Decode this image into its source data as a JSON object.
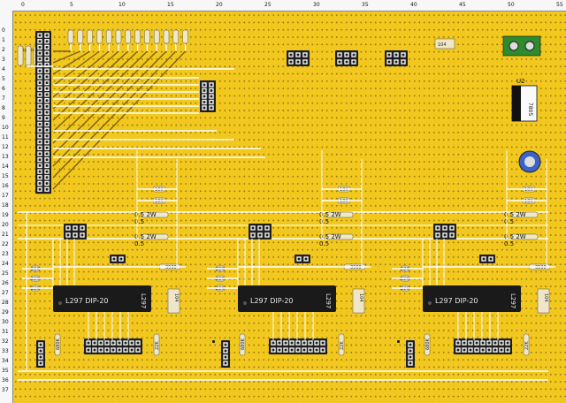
{
  "rulers": {
    "top": [
      "0",
      "5",
      "10",
      "15",
      "20",
      "25",
      "30",
      "35",
      "40",
      "45",
      "50",
      "55"
    ],
    "left": [
      "0",
      "1",
      "2",
      "3",
      "4",
      "5",
      "6",
      "7",
      "8",
      "9",
      "10",
      "11",
      "12",
      "13",
      "14",
      "15",
      "16",
      "17",
      "18",
      "19",
      "20",
      "21",
      "22",
      "23",
      "24",
      "25",
      "26",
      "27",
      "28",
      "29",
      "30",
      "31",
      "32",
      "33",
      "34",
      "35",
      "36",
      "37"
    ]
  },
  "parts": {
    "chip_label": "L297",
    "chip_package": "DIP-20",
    "chip_side": "L297",
    "regulator_name": "U2",
    "regulator_part": "7805",
    "res_10k": "10K",
    "res_05": "0.5",
    "res_05_2w": "0.5  2W",
    "res_3900": "3900",
    "res_22k": "22K",
    "res_680k": "680K",
    "res_1k": "1k",
    "small_cap": "104"
  },
  "colors": {
    "board": "#f2c81f",
    "trace": "#ffffff",
    "chip": "#1a1a1a",
    "terminal": "#2e8b2e"
  }
}
